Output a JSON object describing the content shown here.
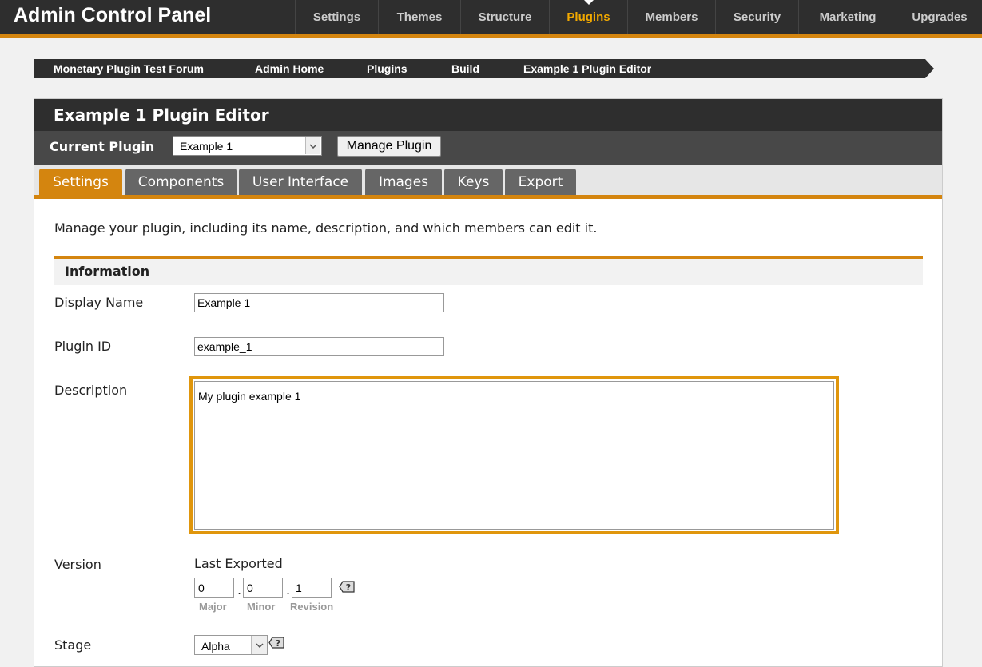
{
  "app": {
    "title": "Admin Control Panel"
  },
  "topnav": [
    {
      "label": "Settings",
      "active": false
    },
    {
      "label": "Themes",
      "active": false
    },
    {
      "label": "Structure",
      "active": false
    },
    {
      "label": "Plugins",
      "active": true
    },
    {
      "label": "Members",
      "active": false
    },
    {
      "label": "Security",
      "active": false
    },
    {
      "label": "Marketing",
      "active": false
    },
    {
      "label": "Upgrades",
      "active": false
    }
  ],
  "breadcrumb": [
    {
      "label": "Monetary Plugin Test Forum"
    },
    {
      "label": "Admin Home"
    },
    {
      "label": "Plugins"
    },
    {
      "label": "Build"
    },
    {
      "label": "Example 1 Plugin Editor"
    }
  ],
  "panel": {
    "title": "Example 1 Plugin Editor",
    "current_plugin_label": "Current Plugin",
    "current_plugin_value": "Example 1",
    "manage_button": "Manage Plugin"
  },
  "tabs": [
    {
      "label": "Settings",
      "active": true
    },
    {
      "label": "Components",
      "active": false
    },
    {
      "label": "User Interface",
      "active": false
    },
    {
      "label": "Images",
      "active": false
    },
    {
      "label": "Keys",
      "active": false
    },
    {
      "label": "Export",
      "active": false
    }
  ],
  "content": {
    "intro": "Manage your plugin, including its name, description, and which members can edit it.",
    "section_title": "Information",
    "display_name": {
      "label": "Display Name",
      "value": "Example 1"
    },
    "plugin_id": {
      "label": "Plugin ID",
      "value": "example_1"
    },
    "description": {
      "label": "Description",
      "value": "My plugin example 1"
    },
    "version": {
      "label": "Version",
      "sublabel": "Last Exported",
      "major": "0",
      "minor": "0",
      "revision": "1",
      "major_caption": "Major",
      "minor_caption": "Minor",
      "revision_caption": "Revision"
    },
    "stage": {
      "label": "Stage",
      "value": "Alpha"
    }
  },
  "colors": {
    "accent": "#d4850f",
    "nav_active": "#f2a900",
    "header_dark": "#2e2e2e",
    "focus_border": "#e0960c"
  },
  "icons": [
    "chevron-down-icon",
    "help-icon"
  ]
}
